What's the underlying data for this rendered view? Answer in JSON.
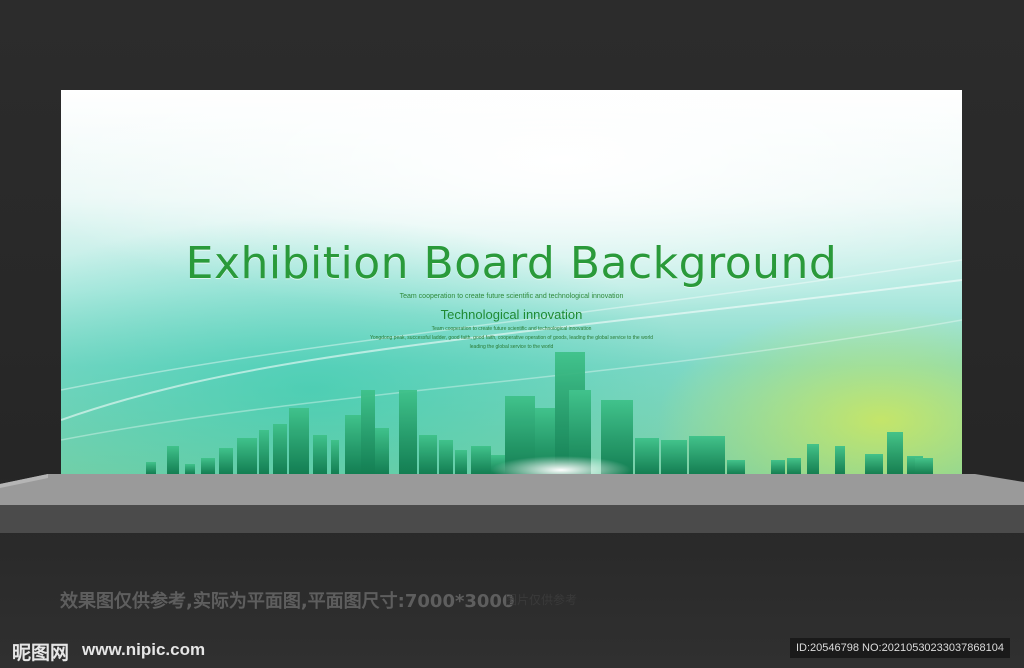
{
  "board": {
    "title": "Exhibition Board Background",
    "tagline": "Team cooperation to create future scientific and technological innovation",
    "subtitle": "Technological innovation",
    "small_line1": "Team cooperation to create future scientific and technological innovation",
    "small_line2": "Yongdong peak, successful ladder, good faith, good faith, cooperative operation of goods, leading the global service to the world",
    "small_line3": "leading the global service to the world"
  },
  "caption": {
    "main": "效果图仅供参考,实际为平面图,平面图尺寸:7000*3000",
    "faint": "图片仅供参考"
  },
  "watermark": {
    "logo": "昵图网",
    "site": "www.nipic.com",
    "id_text": "ID:20546798 NO:20210530233037868104"
  },
  "colors": {
    "title_green": "#2a9a3a",
    "background_dark": "#2a2a2a",
    "stage_gray": "#9a9a9a"
  }
}
